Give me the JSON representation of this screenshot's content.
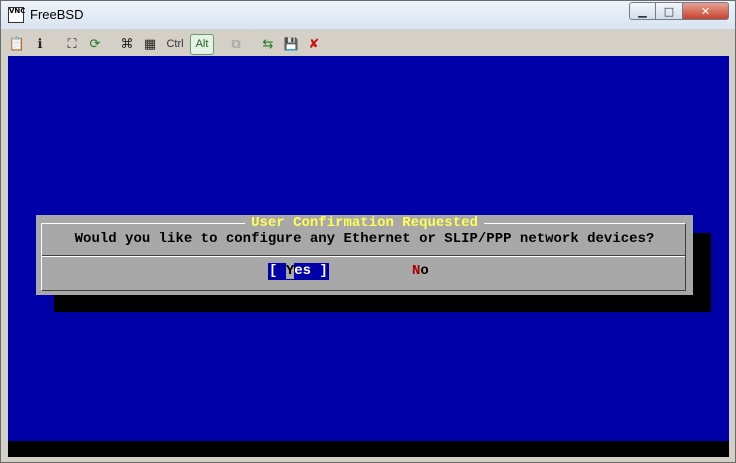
{
  "window": {
    "title": "FreeBSD",
    "app_icon_text": "VNC",
    "controls": {
      "minimize": "▁",
      "maximize": "□",
      "close": "✕"
    }
  },
  "toolbar": {
    "items": [
      {
        "name": "connection-options-icon",
        "glyph": "📋"
      },
      {
        "name": "connection-info-icon",
        "glyph": "ℹ"
      },
      {
        "name": "fullscreen-icon",
        "glyph": "⛶"
      },
      {
        "name": "refresh-icon",
        "glyph": "⟳"
      },
      {
        "name": "ctrl-alt-del-icon",
        "glyph": "⌘"
      },
      {
        "name": "send-keys-icon",
        "glyph": "▦"
      }
    ],
    "ctrl_label": "Ctrl",
    "alt_label": "Alt",
    "trailing_items": [
      {
        "name": "clipboard-icon",
        "glyph": "⧉",
        "disabled": true
      },
      {
        "name": "transfer-icon",
        "glyph": "⇆"
      },
      {
        "name": "save-icon",
        "glyph": "💾"
      },
      {
        "name": "disconnect-icon",
        "glyph": "✘"
      }
    ]
  },
  "dialog": {
    "title": "User Confirmation Requested",
    "message": "Would you like to configure any Ethernet or SLIP/PPP network devices?",
    "yes_prefix": "[ ",
    "yes_hotkey": "Y",
    "yes_rest": "es ]",
    "no_hotkey": "N",
    "no_rest": "o"
  },
  "colors": {
    "terminal_bg": "#0000a8",
    "dialog_bg": "#a8a8a8",
    "title_yellow": "#ffff55",
    "hotkey_red": "#a80000"
  }
}
